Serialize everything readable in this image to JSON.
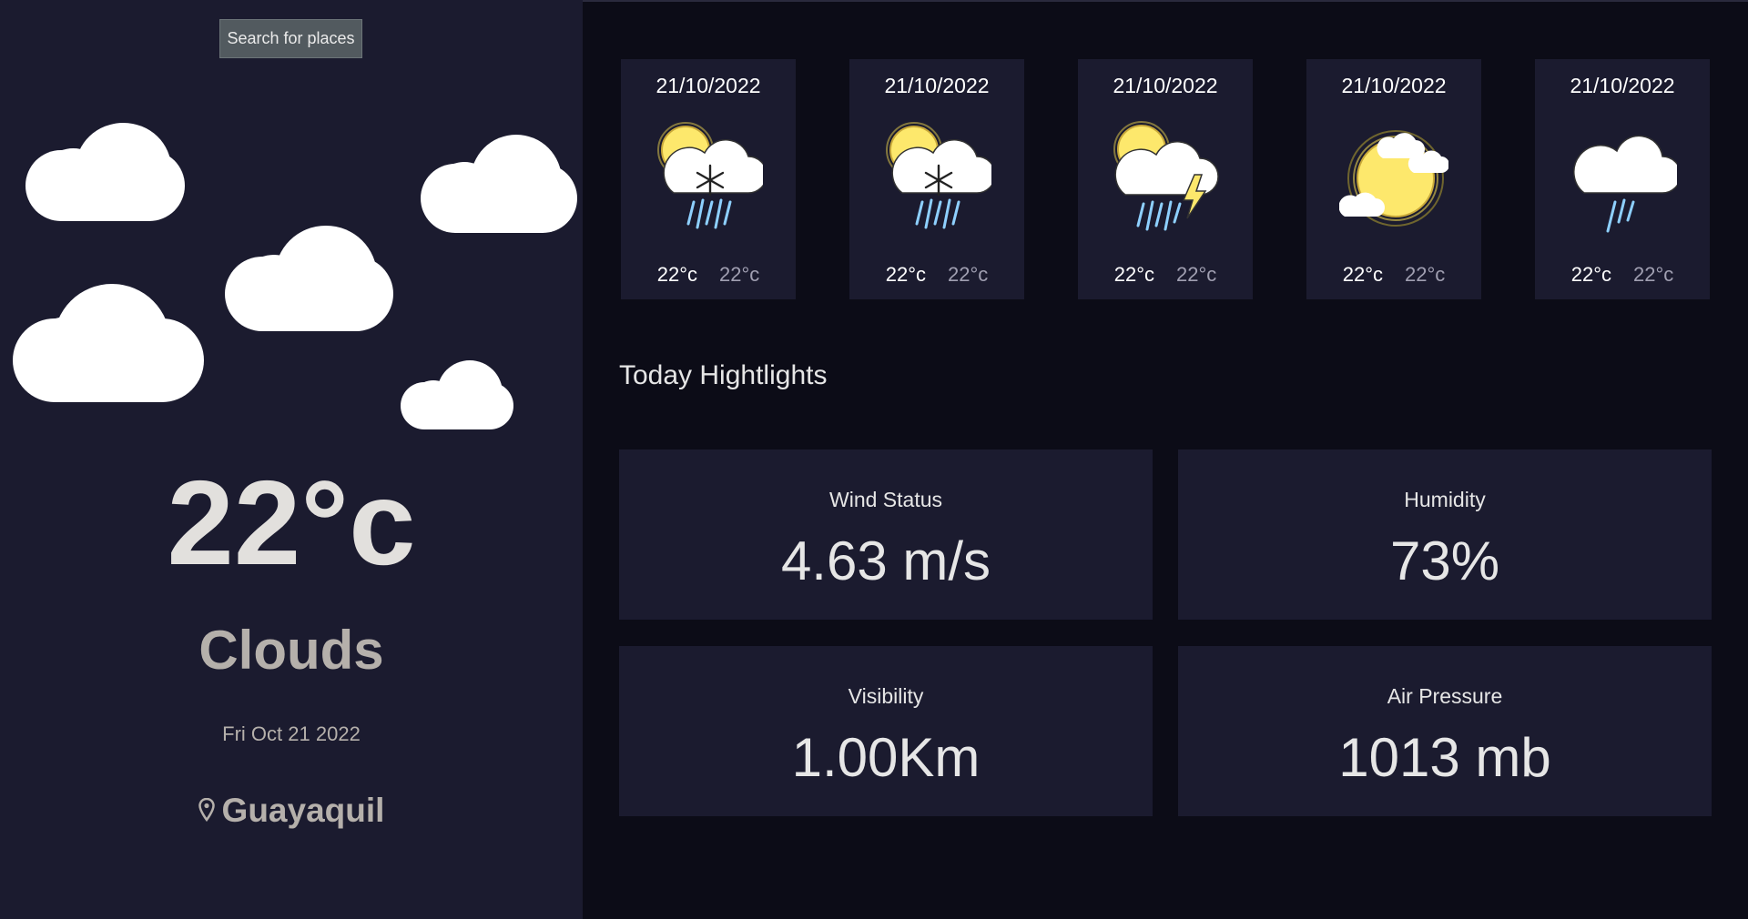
{
  "search": {
    "label": "Search for places"
  },
  "current": {
    "temperature": "22°c",
    "condition": "Clouds",
    "date": "Fri Oct 21 2022",
    "location": "Guayaquil",
    "icon": "clouds-icon"
  },
  "forecast": [
    {
      "date": "21/10/2022",
      "max": "22°c",
      "min": "22°c",
      "icon": "sun-snow-rain-icon"
    },
    {
      "date": "21/10/2022",
      "max": "22°c",
      "min": "22°c",
      "icon": "sun-snow-rain-icon"
    },
    {
      "date": "21/10/2022",
      "max": "22°c",
      "min": "22°c",
      "icon": "sun-thunder-rain-icon"
    },
    {
      "date": "21/10/2022",
      "max": "22°c",
      "min": "22°c",
      "icon": "sun-clouds-icon"
    },
    {
      "date": "21/10/2022",
      "max": "22°c",
      "min": "22°c",
      "icon": "cloud-rain-icon"
    }
  ],
  "highlights": {
    "title": "Today Hightlights",
    "items": [
      {
        "label": "Wind Status",
        "value": "4.63 m/s"
      },
      {
        "label": "Humidity",
        "value": "73%"
      },
      {
        "label": "Visibility",
        "value": "1.00Km"
      },
      {
        "label": "Air Pressure",
        "value": "1013 mb"
      }
    ]
  },
  "colors": {
    "background": "#0c0c17",
    "panel": "#1b1b2f",
    "sun": "#fde86c",
    "rain": "#8ed0ff",
    "text": "#e6e6e6",
    "muted_text": "#a09fb1"
  }
}
